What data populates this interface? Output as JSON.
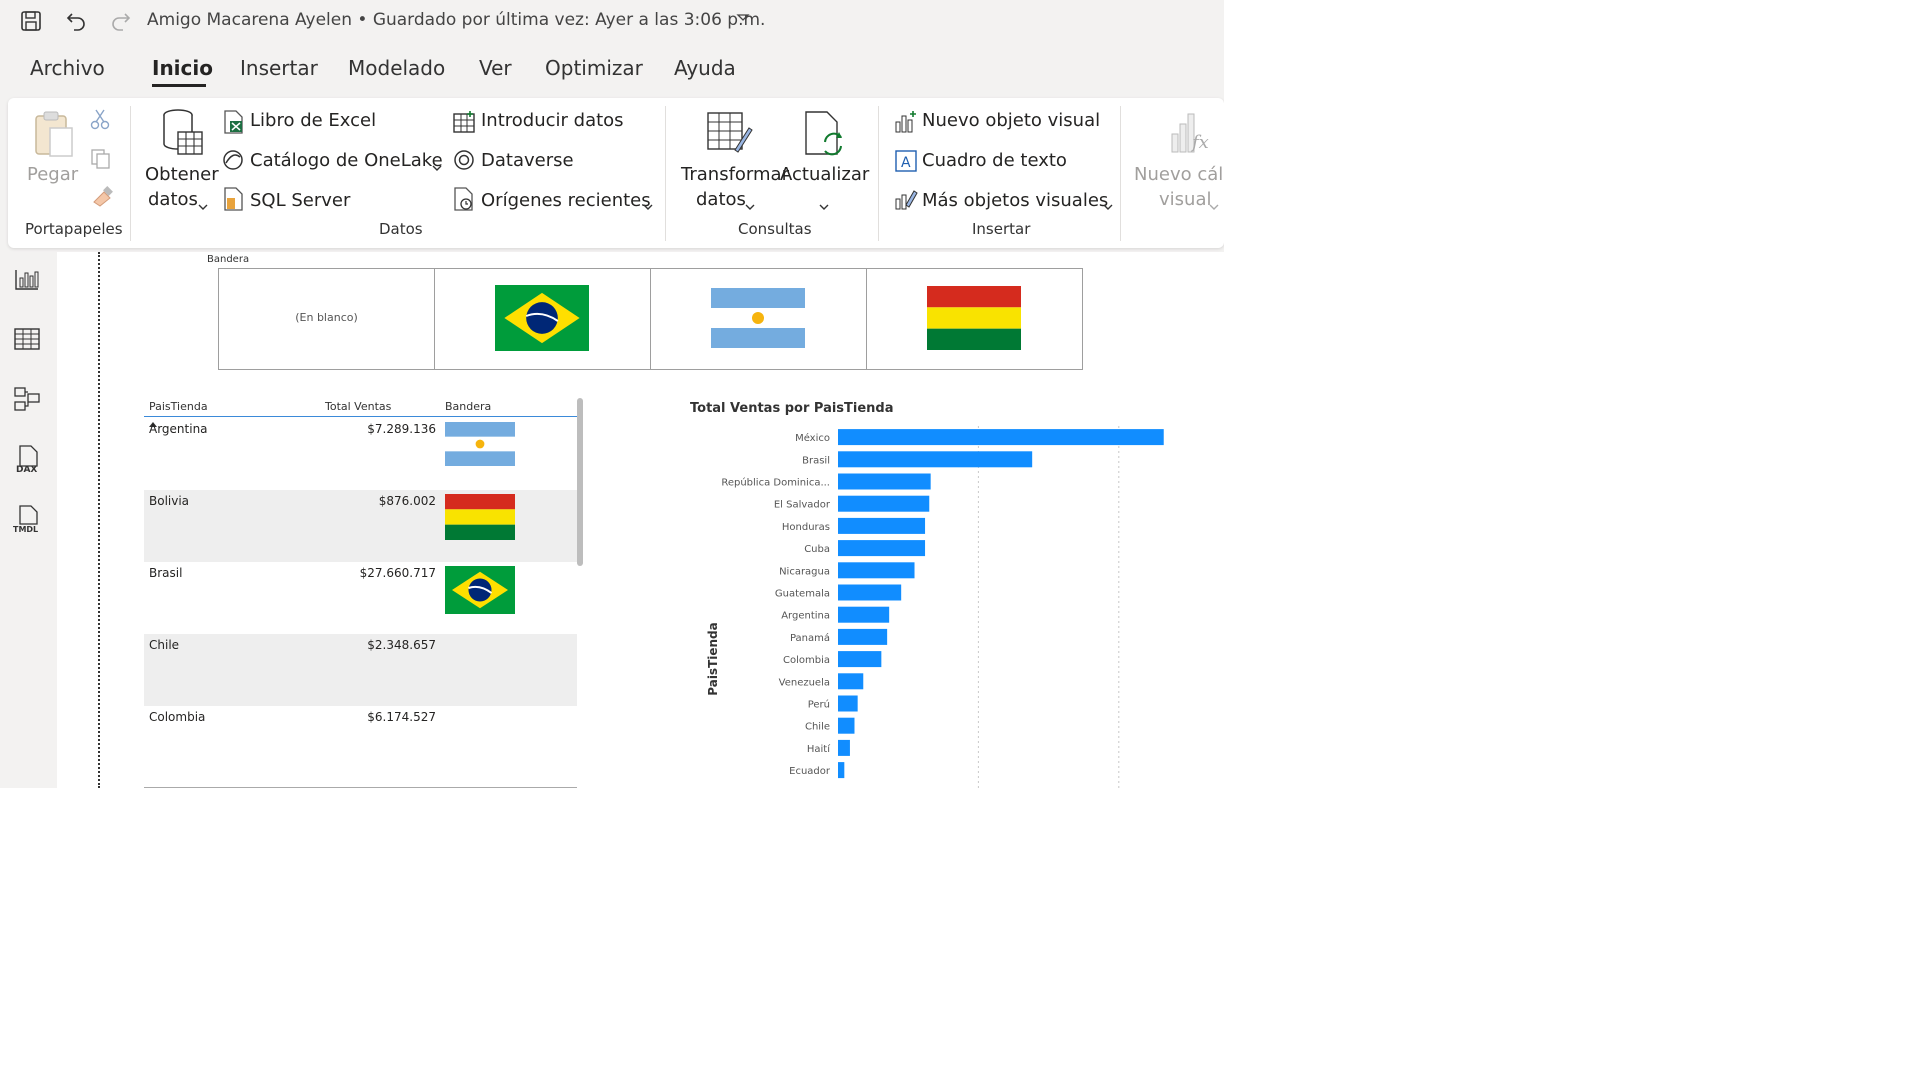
{
  "window": {
    "title": "Amigo Macarena Ayelen • Guardado por última vez: Ayer a las 3:06 p.m."
  },
  "menu": {
    "items": [
      "Archivo",
      "Inicio",
      "Insertar",
      "Modelado",
      "Ver",
      "Optimizar",
      "Ayuda"
    ],
    "active": "Inicio"
  },
  "ribbon": {
    "portapapeles": {
      "paste": "Pegar",
      "label": "Portapapeles"
    },
    "datos": {
      "get_data_line1": "Obtener",
      "get_data_line2": "datos",
      "excel": "Libro de Excel",
      "onelake": "Catálogo de OneLake",
      "sql": "SQL Server",
      "enter_data": "Introducir datos",
      "dataverse": "Dataverse",
      "recent": "Orígenes recientes",
      "label": "Datos"
    },
    "consultas": {
      "transform_line1": "Transformar",
      "transform_line2": "datos",
      "refresh": "Actualizar",
      "label": "Consultas"
    },
    "insertar": {
      "new_visual": "Nuevo objeto visual",
      "text_box": "Cuadro de texto",
      "more_visuals": "Más objetos visuales",
      "label": "Insertar"
    },
    "calc": {
      "line1": "Nuevo cálc",
      "line2": "visual"
    }
  },
  "slicer": {
    "title": "Bandera",
    "tiles": [
      {
        "text": "(En blanco)",
        "flag": ""
      },
      {
        "text": "",
        "flag": "brazil"
      },
      {
        "text": "",
        "flag": "argentina"
      },
      {
        "text": "",
        "flag": "bolivia"
      }
    ]
  },
  "table": {
    "headers": [
      "PaisTienda",
      "Total Ventas",
      "Bandera"
    ],
    "rows": [
      {
        "pais": "Argentina",
        "ventas": "$7.289.136",
        "flag": "argentina"
      },
      {
        "pais": "Bolivia",
        "ventas": "$876.002",
        "flag": "bolivia"
      },
      {
        "pais": "Brasil",
        "ventas": "$27.660.717",
        "flag": "brazil"
      },
      {
        "pais": "Chile",
        "ventas": "$2.348.657",
        "flag": ""
      },
      {
        "pais": "Colombia",
        "ventas": "$6.174.527",
        "flag": ""
      }
    ]
  },
  "colors": {
    "bar": "#118dff",
    "argentina_blue": "#74acdf",
    "argentina_sun": "#f6b40e",
    "bolivia_red": "#d52b1e",
    "bolivia_yellow": "#f9e300",
    "bolivia_green": "#007934",
    "brazil_green": "#009c3b",
    "brazil_yellow": "#ffdf00",
    "brazil_blue": "#002776"
  },
  "chart_data": {
    "type": "bar",
    "orientation": "horizontal",
    "title": "Total Ventas por PaisTienda",
    "ylabel": "PaisTienda",
    "xlabel": "",
    "categories": [
      "México",
      "Brasil",
      "República Dominica...",
      "El Salvador",
      "Honduras",
      "Cuba",
      "Nicaragua",
      "Guatemala",
      "Argentina",
      "Panamá",
      "Colombia",
      "Venezuela",
      "Perú",
      "Chile",
      "Haití",
      "Ecuador"
    ],
    "values": [
      46400000,
      27660717,
      13200000,
      13000000,
      12400000,
      12400000,
      10900000,
      9000000,
      7289136,
      7000000,
      6174527,
      3600000,
      2800000,
      2348657,
      1700000,
      900000
    ],
    "xlim": [
      0,
      50000000
    ],
    "gridlines": [
      20000000,
      40000000
    ],
    "grid": true
  }
}
